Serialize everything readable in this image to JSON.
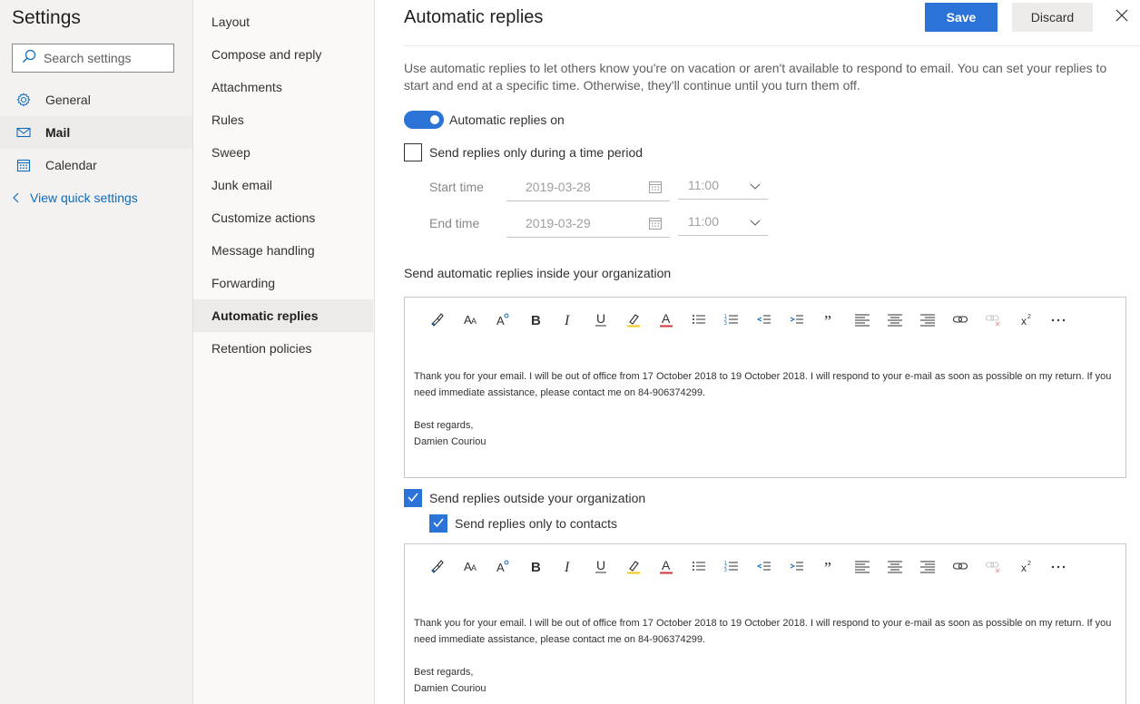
{
  "settings": {
    "title": "Settings",
    "search_placeholder": "Search settings",
    "nav": [
      {
        "label": "General",
        "icon": "gear-icon"
      },
      {
        "label": "Mail",
        "icon": "mail-icon",
        "selected": true
      },
      {
        "label": "Calendar",
        "icon": "calendar-icon"
      }
    ],
    "quick_settings_label": "View quick settings"
  },
  "mail_nav": {
    "items": [
      {
        "label": "Layout"
      },
      {
        "label": "Compose and reply"
      },
      {
        "label": "Attachments"
      },
      {
        "label": "Rules"
      },
      {
        "label": "Sweep"
      },
      {
        "label": "Junk email"
      },
      {
        "label": "Customize actions"
      },
      {
        "label": "Message handling"
      },
      {
        "label": "Forwarding"
      },
      {
        "label": "Automatic replies",
        "selected": true
      },
      {
        "label": "Retention policies"
      }
    ]
  },
  "content": {
    "title": "Automatic replies",
    "save_label": "Save",
    "discard_label": "Discard",
    "description": "Use automatic replies to let others know you're on vacation or aren't available to respond to email. You can set your replies to start and end at a specific time. Otherwise, they'll continue until you turn them off.",
    "toggle_label": "Automatic replies on",
    "toggle_on": true,
    "time_period_label": "Send replies only during a time period",
    "time_period_checked": false,
    "start_time_label": "Start time",
    "start_date": "2019-03-28",
    "start_time": "11:00",
    "end_time_label": "End time",
    "end_date": "2019-03-29",
    "end_time": "11:00",
    "inside_label": "Send automatic replies inside your organization",
    "inside_message": {
      "line1": "Thank you for your email. I will be out of office from 17 October 2018 to 19 October 2018. I will respond to your e-mail as soon as possible on my return. If you need immediate assistance, please contact me on 84-906374299.",
      "regards": "Best regards,",
      "name": "Damien Couriou"
    },
    "outside_label": "Send replies outside your organization",
    "outside_checked": true,
    "contacts_only_label": "Send replies only to contacts",
    "contacts_only_checked": true,
    "outside_message": {
      "line1": "Thank you for your email. I will be out of office from 17 October 2018 to 19 October 2018. I will respond to your e-mail as soon as possible on my return. If you need immediate assistance, please contact me on 84-906374299.",
      "regards": "Best regards,",
      "name": "Damien Couriou"
    }
  },
  "colors": {
    "accent": "#2b73d6",
    "link": "#0f6cbd",
    "pane_bg": "#f3f2f1"
  }
}
